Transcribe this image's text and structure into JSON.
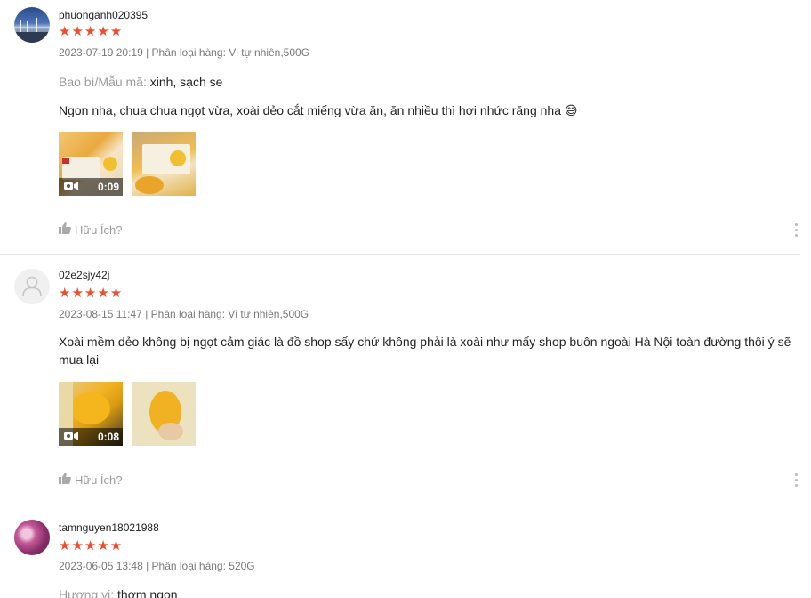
{
  "reviews": [
    {
      "username": "phuonganh020395",
      "stars": "★★★★★",
      "meta": "2023-07-19 20:19 | Phân loại hàng: Vị tự nhiên,500G",
      "attr_key": "Bao bì/Mẫu mã:",
      "attr_val": "xinh, sạch se",
      "content": "Ngon nha, chua chua ngọt vừa, xoài dẻo cắt miếng vừa ăn, ăn nhiều thì hơi nhức răng nha 😅",
      "video_duration": "0:09",
      "helpful": "Hữu Ích?"
    },
    {
      "username": "02e2sjy42j",
      "stars": "★★★★★",
      "meta": "2023-08-15 11:47 | Phân loại hàng: Vị tự nhiên,500G",
      "content": "Xoài mềm dẻo không bị ngọt cảm giác là đồ shop sấy chứ không phải là xoài như mấy shop buôn ngoài Hà Nội toàn đường thôi ý sẽ mua lại",
      "video_duration": "0:08",
      "helpful": "Hữu Ích?"
    },
    {
      "username": "tamnguyen18021988",
      "stars": "★★★★★",
      "meta": "2023-06-05 13:48 | Phân loại hàng: 520G",
      "attr_key": "Hương vị:",
      "attr_val": "thơm ngon"
    }
  ],
  "icons": {
    "video": "video-camera-icon",
    "thumb": "thumbs-up-icon",
    "more": "more-vertical-icon",
    "default_avatar": "user-icon"
  },
  "colors": {
    "star": "#ee4d2d",
    "muted": "#8a8a8a"
  }
}
